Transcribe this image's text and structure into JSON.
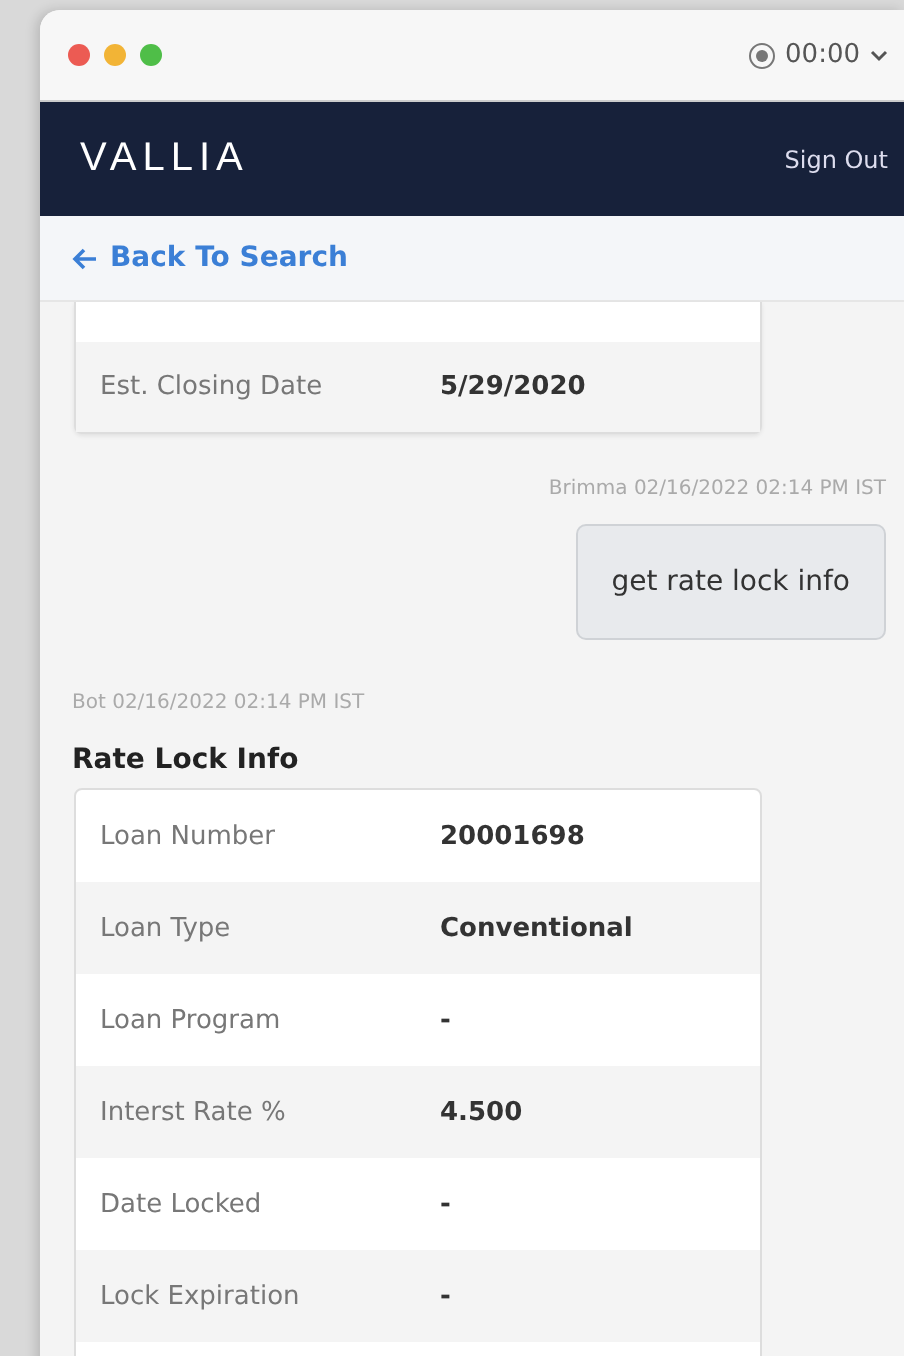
{
  "title_bar": {
    "timer": "00:00"
  },
  "navbar": {
    "logo": "VALLIA",
    "sign_out": "Sign Out"
  },
  "back_link": "Back To Search",
  "messages": [
    {
      "kind": "card",
      "rows": [
        {
          "label": "Est. Closing Date",
          "value": "5/29/2020"
        }
      ]
    },
    {
      "kind": "user",
      "meta": "Brimma 02/16/2022 02:14 PM IST",
      "text": "get rate lock info"
    },
    {
      "kind": "bot",
      "meta": "Bot 02/16/2022 02:14 PM IST",
      "title": "Rate Lock Info",
      "rows": [
        {
          "label": "Loan Number",
          "value": "20001698"
        },
        {
          "label": "Loan Type",
          "value": "Conventional"
        },
        {
          "label": "Loan Program",
          "value": "-"
        },
        {
          "label": "Interst Rate %",
          "value": "4.500"
        },
        {
          "label": "Date Locked",
          "value": "-"
        },
        {
          "label": "Lock Expiration",
          "value": "-"
        }
      ]
    }
  ]
}
